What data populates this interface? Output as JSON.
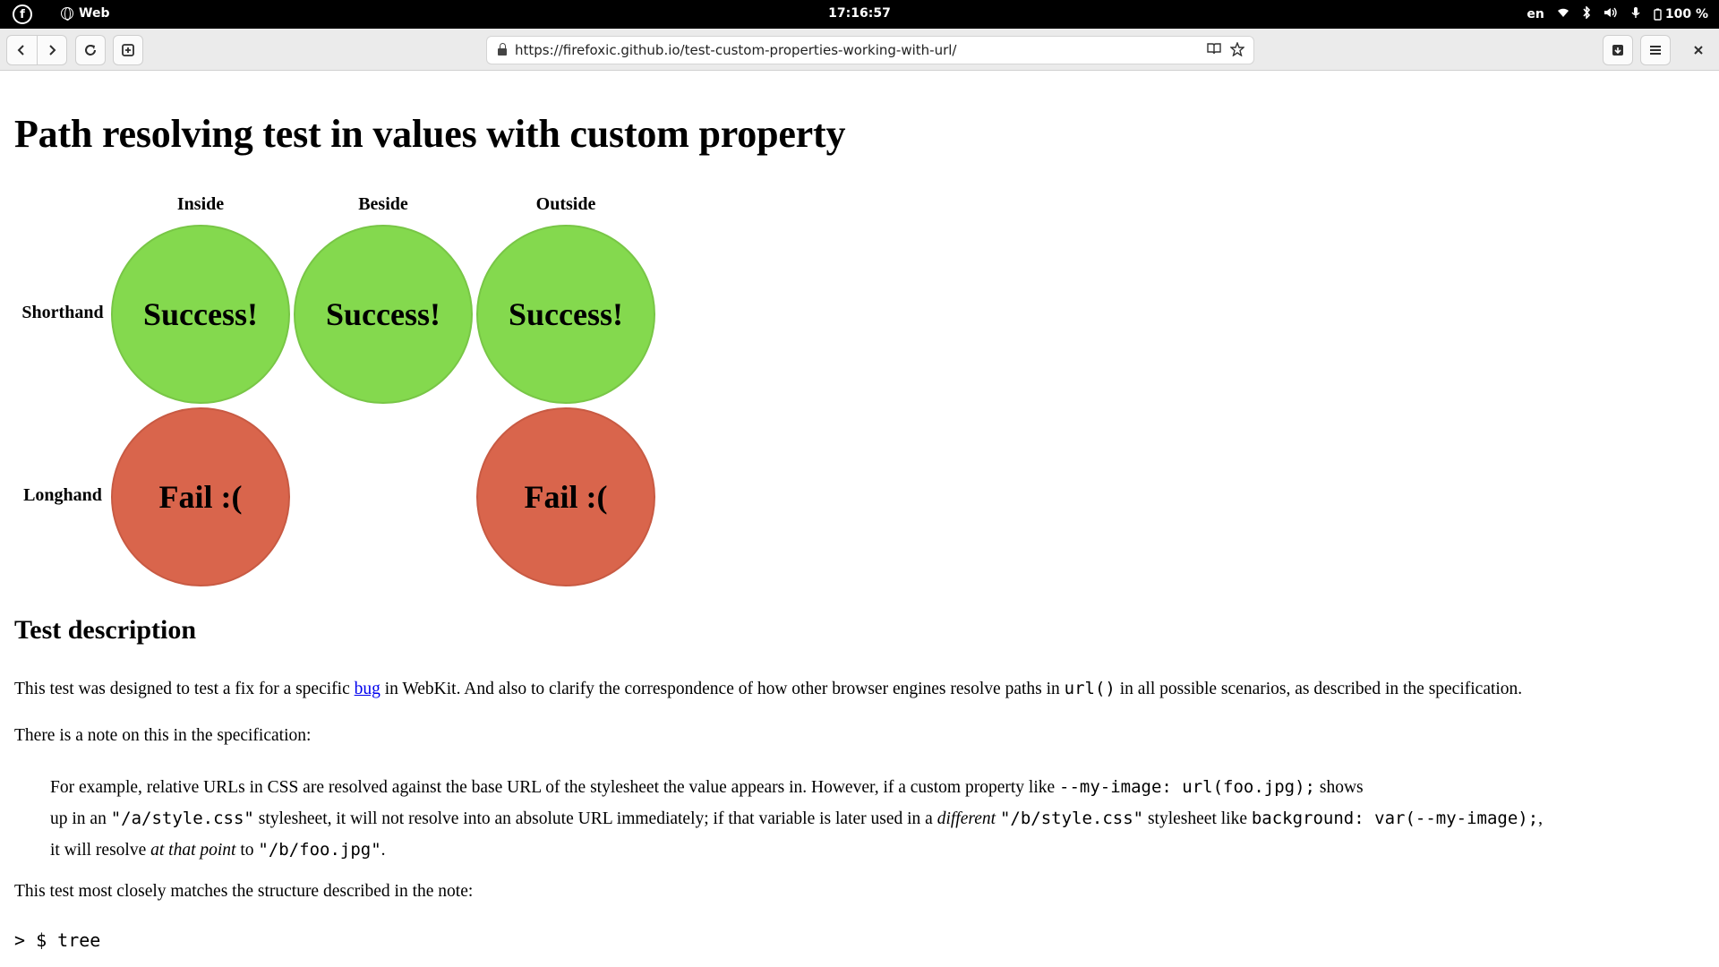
{
  "system_bar": {
    "app_name": "Web",
    "clock": "17:16:57",
    "language": "en",
    "battery": "100 %"
  },
  "browser": {
    "url": "https://firefoxic.github.io/test-custom-properties-working-with-url/",
    "icons": [
      "back-icon",
      "forward-icon",
      "reload-icon",
      "new-tab-icon",
      "reader-mode-icon",
      "bookmark-star-icon",
      "downloads-icon",
      "menu-icon",
      "close-icon"
    ]
  },
  "page": {
    "title": "Path resolving test in values with custom property",
    "columns": [
      "Inside",
      "Beside",
      "Outside"
    ],
    "rows": [
      "Shorthand",
      "Longhand"
    ],
    "results": {
      "shorthand_inside": "Success!",
      "shorthand_beside": "Success!",
      "shorthand_outside": "Success!",
      "longhand_inside": "Fail :(",
      "longhand_outside": "Fail :("
    },
    "colors": {
      "success": "#84d94e",
      "fail": "#d9654c"
    },
    "desc_heading": "Test description",
    "p1": {
      "before": "This test was designed to test a fix for a specific ",
      "link": "bug",
      "middle": " in WebKit. And also to clarify the correspondence of how other browser engines resolve paths in ",
      "code": "url()",
      "after": " in all possible scenarios, as described in the specification."
    },
    "p2": "There is a note on this in the specification:",
    "quote": {
      "l1_a": "For example, relative URLs in CSS are resolved against the base URL of the stylesheet the value appears in. However, if a custom property like ",
      "l1_code": "--my-image: url(foo.jpg);",
      "l1_b": " shows",
      "l2_a": "up in an ",
      "l2_code1": "\"/a/style.css\"",
      "l2_b": " stylesheet, it will not resolve into an absolute URL immediately; if that variable is later used in a ",
      "l2_em": "different",
      "l2_c": " ",
      "l2_code2": "\"/b/style.css\"",
      "l2_d": " stylesheet like ",
      "l2_code3": "background: var(--my-image);",
      "l2_e": ",",
      "l3_a": "it will resolve ",
      "l3_em": "at that point",
      "l3_b": " to ",
      "l3_code": "\"/b/foo.jpg\"",
      "l3_c": "."
    },
    "p3": "This test most closely matches the structure described in the note:",
    "pre": "> $ tree"
  }
}
